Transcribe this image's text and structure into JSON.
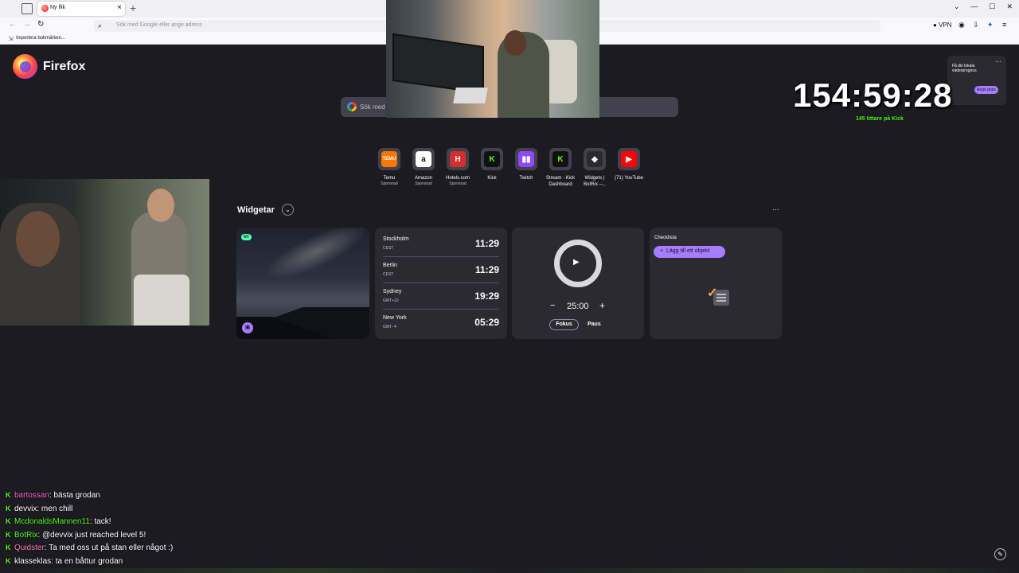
{
  "browser": {
    "tab_title": "Ny flik",
    "url_placeholder": "Sök med Google eller ange adress",
    "vpn_label": "VPN",
    "bookmark_import": "Importera bokmärken..."
  },
  "newtab": {
    "brand": "Firefox",
    "search_placeholder": "Sök med Google",
    "weather": {
      "text": "Få din lokala väderprognos",
      "button": "Ange plats"
    },
    "top_sites": [
      {
        "title": "Temu",
        "sponsored": "Sponsrad",
        "logo": "TEMU",
        "bg": "#fb7701",
        "fg": "#ffffff"
      },
      {
        "title": "Amazon",
        "sponsored": "Sponsrad",
        "logo": "a",
        "bg": "#ffffff",
        "fg": "#111111"
      },
      {
        "title": "Hotels.com",
        "sponsored": "Sponsrad",
        "logo": "H",
        "bg": "#d32f2f",
        "fg": "#ffffff"
      },
      {
        "title": "Kick",
        "sponsored": "",
        "logo": "K",
        "bg": "#111111",
        "fg": "#53fc18"
      },
      {
        "title": "Twitch",
        "sponsored": "",
        "logo": "▮▮",
        "bg": "#9146ff",
        "fg": "#ffffff"
      },
      {
        "title": "Stream - Kick Dashboard",
        "sponsored": "",
        "logo": "K",
        "bg": "#111111",
        "fg": "#53fc18"
      },
      {
        "title": "Widgets | BotRix –...",
        "sponsored": "",
        "logo": "◆",
        "bg": "#2b2a33",
        "fg": "#ffffff"
      },
      {
        "title": "(71) YouTube",
        "sponsored": "",
        "logo": "▶",
        "bg": "#ff0000",
        "fg": "#ffffff"
      }
    ],
    "widgets": {
      "title": "Widgetar",
      "wallpaper_badge": "NY",
      "clocks": [
        {
          "city": "Stockholm",
          "tz": "CEST",
          "time": "11:29"
        },
        {
          "city": "Berlin",
          "tz": "CEST",
          "time": "11:29"
        },
        {
          "city": "Sydney",
          "tz": "GMT+10",
          "time": "19:29"
        },
        {
          "city": "New York",
          "tz": "GMT−4",
          "time": "05:29"
        }
      ],
      "timer": {
        "value": "25:00",
        "focus": "Fokus",
        "break": "Paus"
      },
      "list": {
        "title": "Checklista",
        "add": "Lägg till ett objekt"
      }
    }
  },
  "stream": {
    "timer": "154:59:28",
    "viewers": "145 tittare på Kick",
    "chat": [
      {
        "user": "bartossan",
        "color": "#ff5fd3",
        "message": "bästa grodan"
      },
      {
        "user": "devvix",
        "color": "#ffffff",
        "message": "men chill"
      },
      {
        "user": "McdonaldsMannen11",
        "color": "#53fc18",
        "message": "tack!"
      },
      {
        "user": "BotRix",
        "color": "#53fc18",
        "message": "@devvix just reached level 5!"
      },
      {
        "user": "Quidster",
        "color": "#ff7ab8",
        "message": "Ta med oss ut på stan eller något :)"
      },
      {
        "user": "klasseklas",
        "color": "#ffffff",
        "message": "ta en båttur grodan"
      }
    ]
  }
}
